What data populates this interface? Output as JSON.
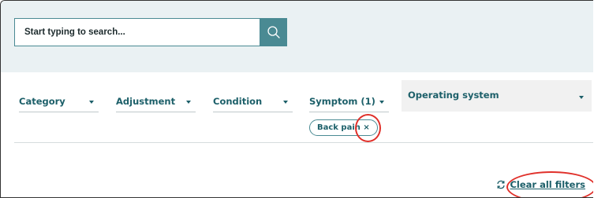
{
  "search": {
    "placeholder": "Start typing to search...",
    "button_icon": "search-icon"
  },
  "filters": {
    "dropdowns": [
      {
        "label": "Category"
      },
      {
        "label": "Adjustment"
      },
      {
        "label": "Condition"
      },
      {
        "label": "Symptom (1)"
      }
    ],
    "os_dropdown": {
      "label": "Operating system"
    },
    "active_chips": [
      {
        "label": "Back pain ×"
      }
    ]
  },
  "actions": {
    "clear_all_label": "Clear all filters",
    "clear_icon": "refresh-icon"
  },
  "colors": {
    "accent": "#4a8a93",
    "text_teal": "#1c5f69",
    "annotation_red": "#e0302a",
    "search_band": "#eaf1f3"
  }
}
